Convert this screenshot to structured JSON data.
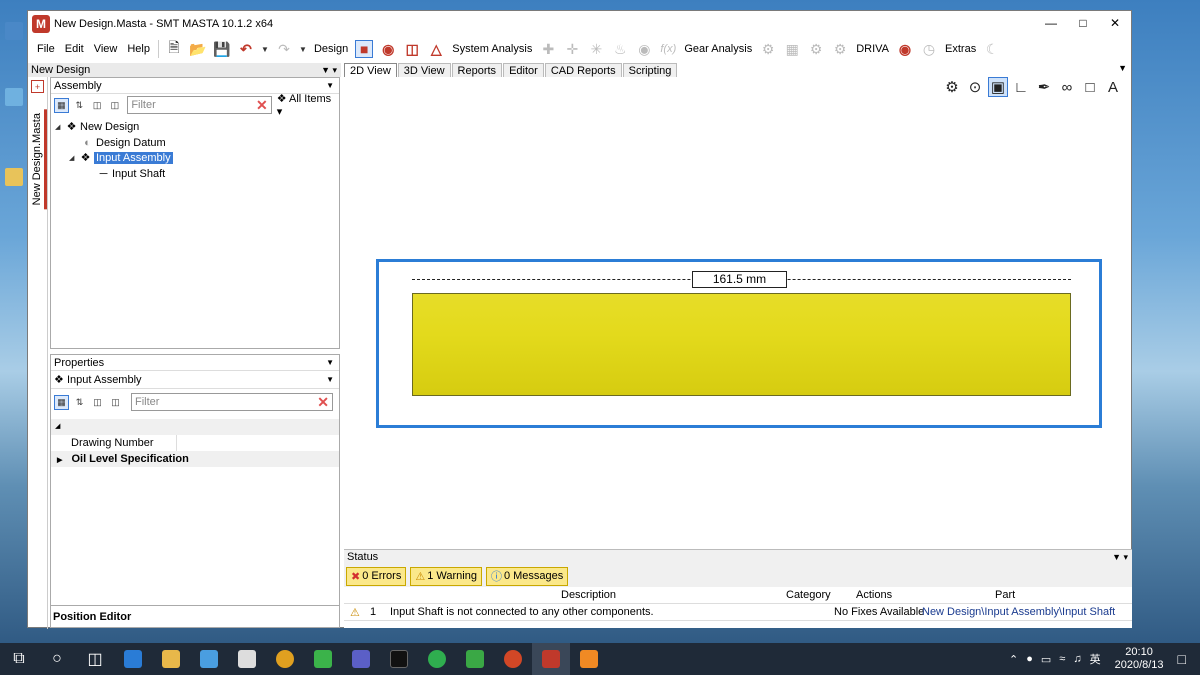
{
  "window": {
    "title": "New Design.Masta - SMT MASTA 10.1.2 x64",
    "logo": "M"
  },
  "menu": [
    "File",
    "Edit",
    "View",
    "Help"
  ],
  "toolbar": {
    "design_label": "Design",
    "system_analysis_label": "System Analysis",
    "gear_analysis_label": "Gear Analysis",
    "driva_label": "DRIVA",
    "extras_label": "Extras"
  },
  "left": {
    "design_bar": "New Design",
    "vertical_tab": "New Design.Masta",
    "assembly_panel": {
      "title": "Assembly",
      "filter_placeholder": "Filter",
      "scope": "All Items"
    },
    "tree": [
      {
        "label": "New Design",
        "icon": "assembly-icon"
      },
      {
        "label": "Design Datum",
        "icon": "datum-icon"
      },
      {
        "label": "Input Assembly",
        "icon": "assembly-icon"
      },
      {
        "label": "Input Shaft",
        "icon": "shaft-icon"
      }
    ],
    "properties_panel": {
      "title": "Properties",
      "selected": "Input Assembly",
      "filter_placeholder": "Filter",
      "rows": [
        {
          "label": "Drawing Number"
        },
        {
          "label": "Oil Level Specification"
        }
      ]
    },
    "footer": "Position Editor"
  },
  "tabs": [
    "2D View",
    "3D View",
    "Reports",
    "Editor",
    "CAD Reports",
    "Scripting"
  ],
  "active_tab": "2D View",
  "view": {
    "dimension": "161.5 mm",
    "shaft_color": "#e3da1c",
    "frame_color": "#2b7dd6"
  },
  "status": {
    "title": "Status",
    "errors": "0 Errors",
    "warnings": "1 Warning",
    "messages": "0 Messages",
    "columns": [
      "Description",
      "Category",
      "Actions",
      "Part"
    ],
    "rows": [
      {
        "index": "1",
        "description": "Input Shaft is not connected to any other components.",
        "category": "",
        "actions": "No Fixes Available",
        "part": "New Design\\Input Assembly\\Input Shaft"
      }
    ]
  },
  "taskbar": {
    "time": "20:10",
    "date": "2020/8/13",
    "ime": "英"
  }
}
